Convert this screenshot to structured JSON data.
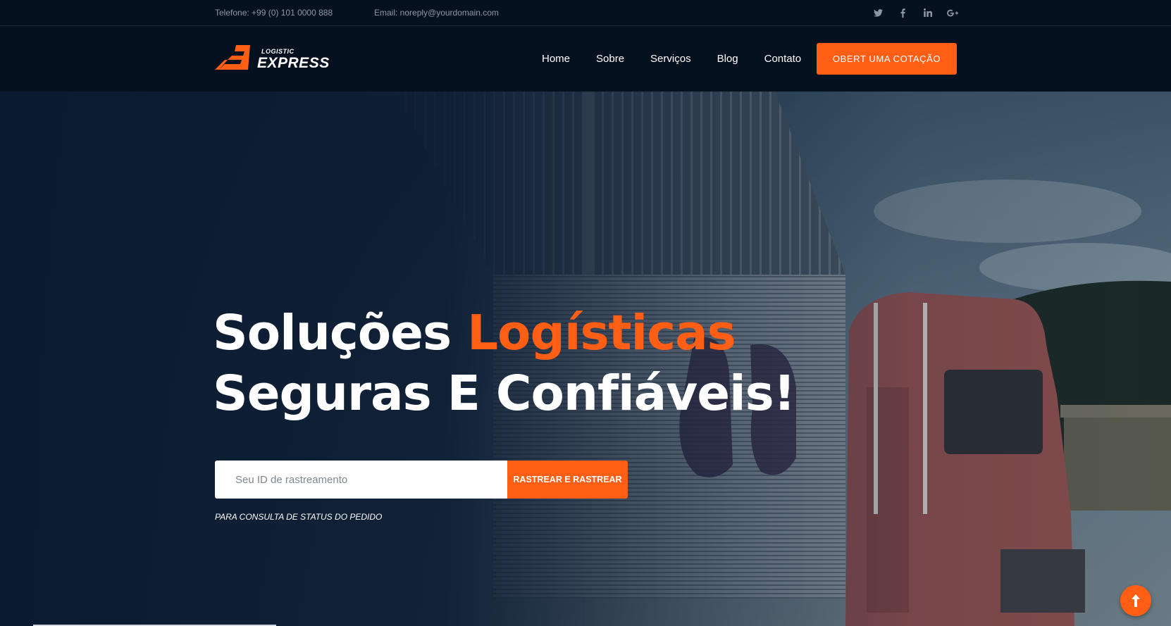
{
  "topbar": {
    "phone": "Telefone: +99 (0) 101 0000 888",
    "email": "Email: noreply@yourdomain.com",
    "socials": [
      "twitter-icon",
      "facebook-icon",
      "linkedin-icon",
      "google-plus-icon"
    ]
  },
  "header": {
    "logo_small": "LOGISTIC",
    "logo_big": "EXPRESS",
    "nav": [
      "Home",
      "Sobre",
      "Serviços",
      "Blog",
      "Contato"
    ],
    "cta_label": "OBERT UMA COTAÇÃO"
  },
  "hero": {
    "headline_part1": "Soluções",
    "headline_accent": "Logísticas",
    "headline_line2": "Seguras E Confiáveis!",
    "tracking_placeholder": "Seu ID de rastreamento",
    "track_button": "RASTREAR E RASTREAR",
    "note": "PARA CONSULTA DE STATUS DO PEDIDO"
  },
  "colors": {
    "accent": "#ff5e14",
    "dark_navy": "#06111f",
    "text_muted": "#8d96a5"
  }
}
